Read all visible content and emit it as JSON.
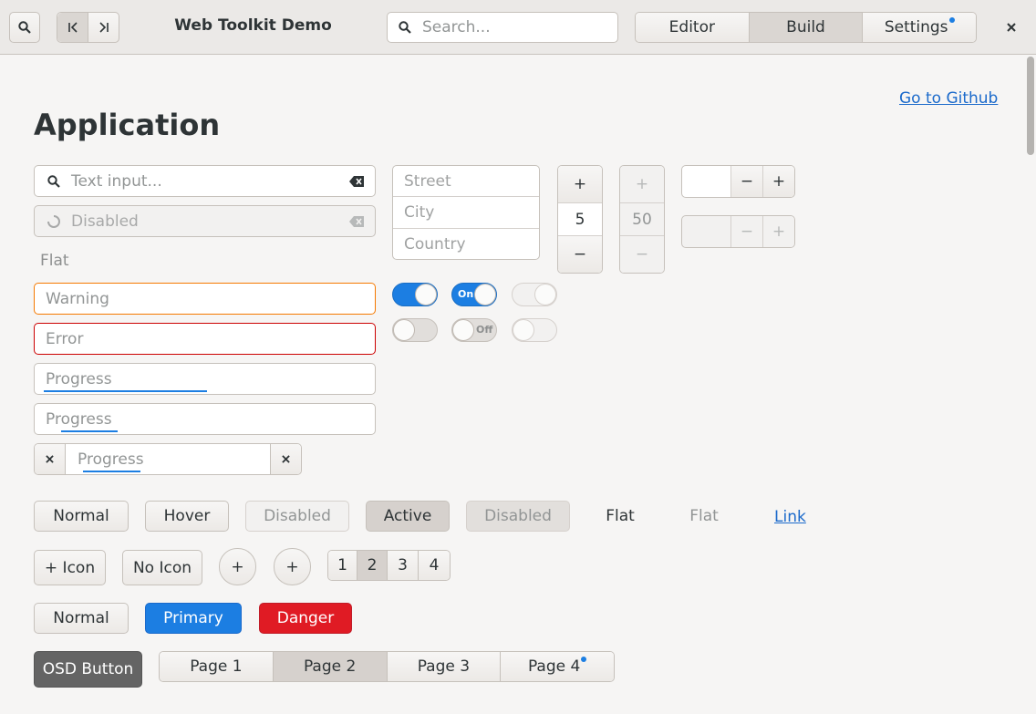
{
  "header": {
    "search_icon": "search-icon",
    "nav_first_icon": "skip-first-icon",
    "nav_last_icon": "skip-last-icon",
    "title": "Web Toolkit Demo",
    "search_placeholder": "Search...",
    "tabs": [
      {
        "label": "Editor",
        "active": false,
        "badge": false
      },
      {
        "label": "Build",
        "active": true,
        "badge": false
      },
      {
        "label": "Settings",
        "active": false,
        "badge": true
      }
    ],
    "close_icon": "close-icon"
  },
  "colors": {
    "accent": "#1c7ee2",
    "danger": "#e01b24",
    "warning": "#f57900",
    "error": "#cc0000"
  },
  "github_link": "Go to Github",
  "section_title": "Application",
  "entries": {
    "text_input_placeholder": "Text input...",
    "disabled_placeholder": "Disabled",
    "flat_placeholder": "Flat",
    "warning_placeholder": "Warning",
    "error_placeholder": "Error",
    "progress1_placeholder": "Progress",
    "progress1_fraction": 0.49,
    "progress2_placeholder": "Progress",
    "progress2_fraction": 0.17,
    "progress3_placeholder": "Progress",
    "progress3_fraction": 0.28
  },
  "address": [
    "Street",
    "City",
    "Country"
  ],
  "spin_vertical": {
    "value": "5",
    "inc": "+",
    "dec": "−"
  },
  "spin_vertical_disabled": {
    "value": "50",
    "inc": "+",
    "dec": "−"
  },
  "spin_horizontal": {
    "value": "",
    "dec": "−",
    "inc": "+"
  },
  "spin_horizontal_disabled": {
    "value": "",
    "dec": "−",
    "inc": "+"
  },
  "switches": {
    "on_label": "On",
    "off_label": "Off"
  },
  "buttons_row1": {
    "normal": "Normal",
    "hover": "Hover",
    "disabled": "Disabled",
    "active": "Active",
    "active_disabled": "Disabled",
    "flat": "Flat",
    "flat_disabled": "Flat",
    "link": "Link"
  },
  "buttons_row2": {
    "icon_button": "+ Icon",
    "no_icon": "No Icon",
    "round_add_1": "+",
    "round_add_2": "+",
    "pager": [
      "1",
      "2",
      "3",
      "4"
    ],
    "pager_selected": "2"
  },
  "buttons_row3": {
    "normal": "Normal",
    "primary": "Primary",
    "danger": "Danger"
  },
  "buttons_row4": {
    "osd": "OSD Button",
    "pages": [
      {
        "label": "Page 1",
        "selected": false,
        "badge": false
      },
      {
        "label": "Page 2",
        "selected": true,
        "badge": false
      },
      {
        "label": "Page 3",
        "selected": false,
        "badge": false
      },
      {
        "label": "Page 4",
        "selected": false,
        "badge": true
      }
    ]
  }
}
